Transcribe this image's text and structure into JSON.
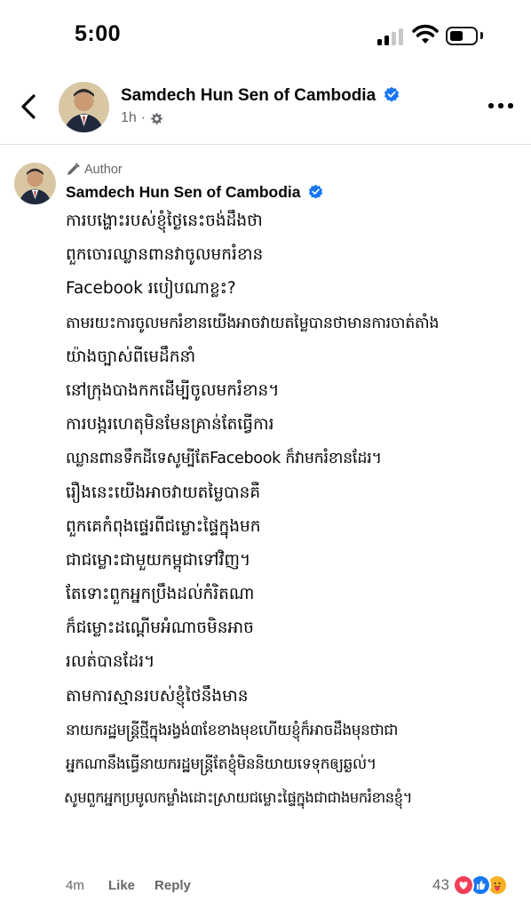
{
  "status_bar": {
    "time": "5:00",
    "icons": [
      "signal-icon",
      "wifi-icon",
      "battery-icon"
    ]
  },
  "header": {
    "page_name": "Samdech Hun Sen of Cambodia",
    "meta_time": "1h",
    "meta_separator": "·",
    "icons": [
      "back-arrow-icon",
      "verified-badge-icon",
      "gear-icon",
      "more-options-icon"
    ]
  },
  "comment": {
    "author_badge": "Author",
    "author_name": "Samdech Hun Sen of Cambodia",
    "lines": [
      "ការបង្ហោះរបស់ខ្ញុំថ្ងៃនេះចង់ដឹងថា",
      "ពួកចោរឈ្លានពានវាចូលមករំខាន",
      "Facebook របៀបណាខ្លះ?",
      "តាមរយះការចូលមករំខានយើងអាចវាយតម្លៃបានថាមានការចាត់តាំង",
      "យ៉ាងច្បាស់ពីមេដឹកនាំ",
      "នៅក្រុងបាងកកដើម្បីចូលមករំខាន។",
      "ការបង្ករហេតុមិនមែនគ្រាន់តែធ្វើការ",
      "ឈ្លានពានទឹកដីទេសូម្បីតែFacebook ក៏វាមករំខានដែរ។",
      "រឿងនេះយើងអាចវាយតម្លៃបានគឺ",
      "ពួកគេកំពុងផ្ទេរពីជម្លោះផ្ទៃក្នុងមក",
      "ជាជម្លោះជាមួយកម្ពុជាទៅវិញ។",
      "តែទោះពួកអ្នកប្រឹងដល់កំរិតណា",
      "ក៏ជម្លោះដណ្តើមអំណាចមិនអាច",
      "រលត់បានដែរ។",
      "តាមការស្មានរបស់ខ្ញុំថៃនឹងមាន",
      "នាយករដ្ឋមន្ត្រីថ្មីក្នុងរង្វង់៣ខែខាងមុខហើយខ្ញុំក៏អាចដឹងមុនថាជា",
      "អ្នកណានឹងធ្វើនាយករដ្ឋមន្ត្រីតែខ្ញុំមិននិយាយទេទុកឲ្យឆ្ងល់។",
      "សូមពួកអ្នកប្រមូលកម្លាំងដោះស្រាយជម្លោះផ្ទៃក្នុងជាជាងមករំខានខ្ញុំ។"
    ],
    "time": "4m",
    "like_label": "Like",
    "reply_label": "Reply",
    "reaction_count": "43",
    "reaction_icons": [
      "love-reaction-icon",
      "like-reaction-icon",
      "care-reaction-icon"
    ]
  },
  "colors": {
    "text": "#050505",
    "secondary": "#65676b",
    "verified_blue": "#1877f2",
    "divider": "#dddfe2",
    "love": "#f33e58",
    "care": "#f7b125"
  }
}
